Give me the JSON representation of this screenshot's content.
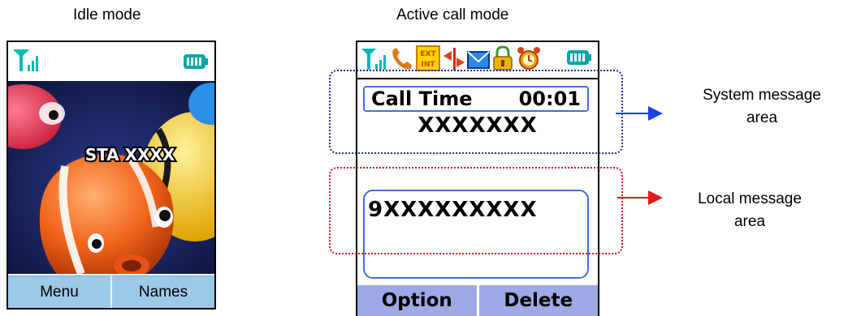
{
  "captions": {
    "idle": "Idle mode",
    "active": "Active call mode"
  },
  "idle_phone": {
    "wallpaper_text": "STA XXXX",
    "softkeys": {
      "left": "Menu",
      "right": "Names"
    }
  },
  "active_phone": {
    "status_icons": [
      "signal-icon",
      "phone-handset-icon",
      "ext-int-icon",
      "call-transfer-icon",
      "envelope-icon",
      "lock-icon",
      "alarm-clock-icon",
      "battery-icon"
    ],
    "call_time_label": "Call Time",
    "call_time_value": "00:01",
    "caller_id": "XXXXXXX",
    "dialed_number": "9XXXXXXXXX",
    "softkeys": {
      "left": "Option",
      "right": "Delete"
    }
  },
  "annotations": {
    "system": {
      "line1": "System message",
      "line2": "area"
    },
    "local": {
      "line1": "Local message",
      "line2": "area"
    }
  },
  "colors": {
    "system_arrow": "#1f3fe0",
    "local_arrow": "#e0181e",
    "idle_softkey": "#9cc9e6",
    "active_softkey": "#9ea9e6"
  }
}
